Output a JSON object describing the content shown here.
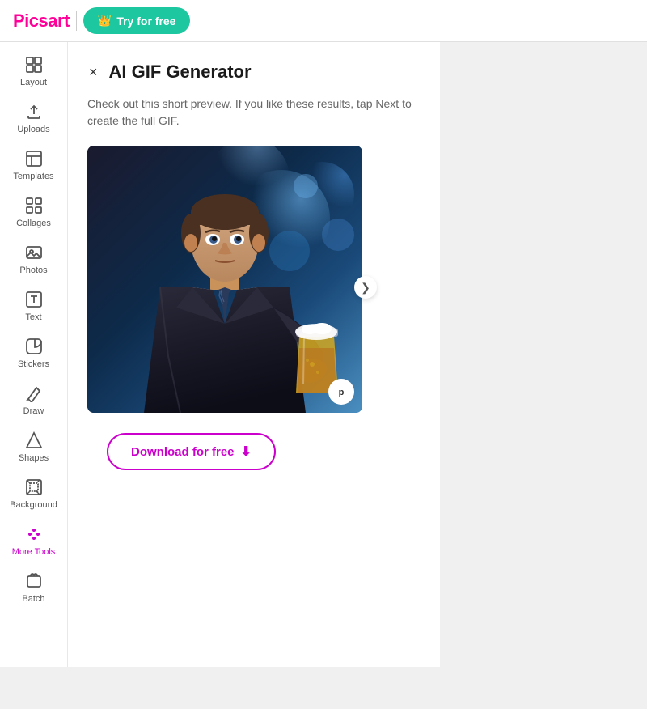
{
  "header": {
    "logo": "Picsart",
    "try_button": "Try for free",
    "crown_icon": "👑"
  },
  "sidebar": {
    "items": [
      {
        "id": "layout",
        "label": "Layout",
        "icon": "layout"
      },
      {
        "id": "uploads",
        "label": "Uploads",
        "icon": "uploads"
      },
      {
        "id": "templates",
        "label": "Templates",
        "icon": "templates"
      },
      {
        "id": "collages",
        "label": "Collages",
        "icon": "collages"
      },
      {
        "id": "photos",
        "label": "Photos",
        "icon": "photos"
      },
      {
        "id": "text",
        "label": "Text",
        "icon": "text"
      },
      {
        "id": "stickers",
        "label": "Stickers",
        "icon": "stickers"
      },
      {
        "id": "draw",
        "label": "Draw",
        "icon": "draw"
      },
      {
        "id": "shapes",
        "label": "Shapes",
        "icon": "shapes"
      },
      {
        "id": "background",
        "label": "Background",
        "icon": "background"
      },
      {
        "id": "more-tools",
        "label": "More Tools",
        "icon": "more-tools",
        "active": true
      },
      {
        "id": "batch",
        "label": "Batch",
        "icon": "batch"
      }
    ]
  },
  "panel": {
    "title": "AI GIF Generator",
    "description": "Check out this short preview. If you like these results, tap Next to create the full GIF.",
    "close_icon": "×",
    "download_button": "Download for free",
    "picsart_badge": "p",
    "chevron": "❯"
  }
}
